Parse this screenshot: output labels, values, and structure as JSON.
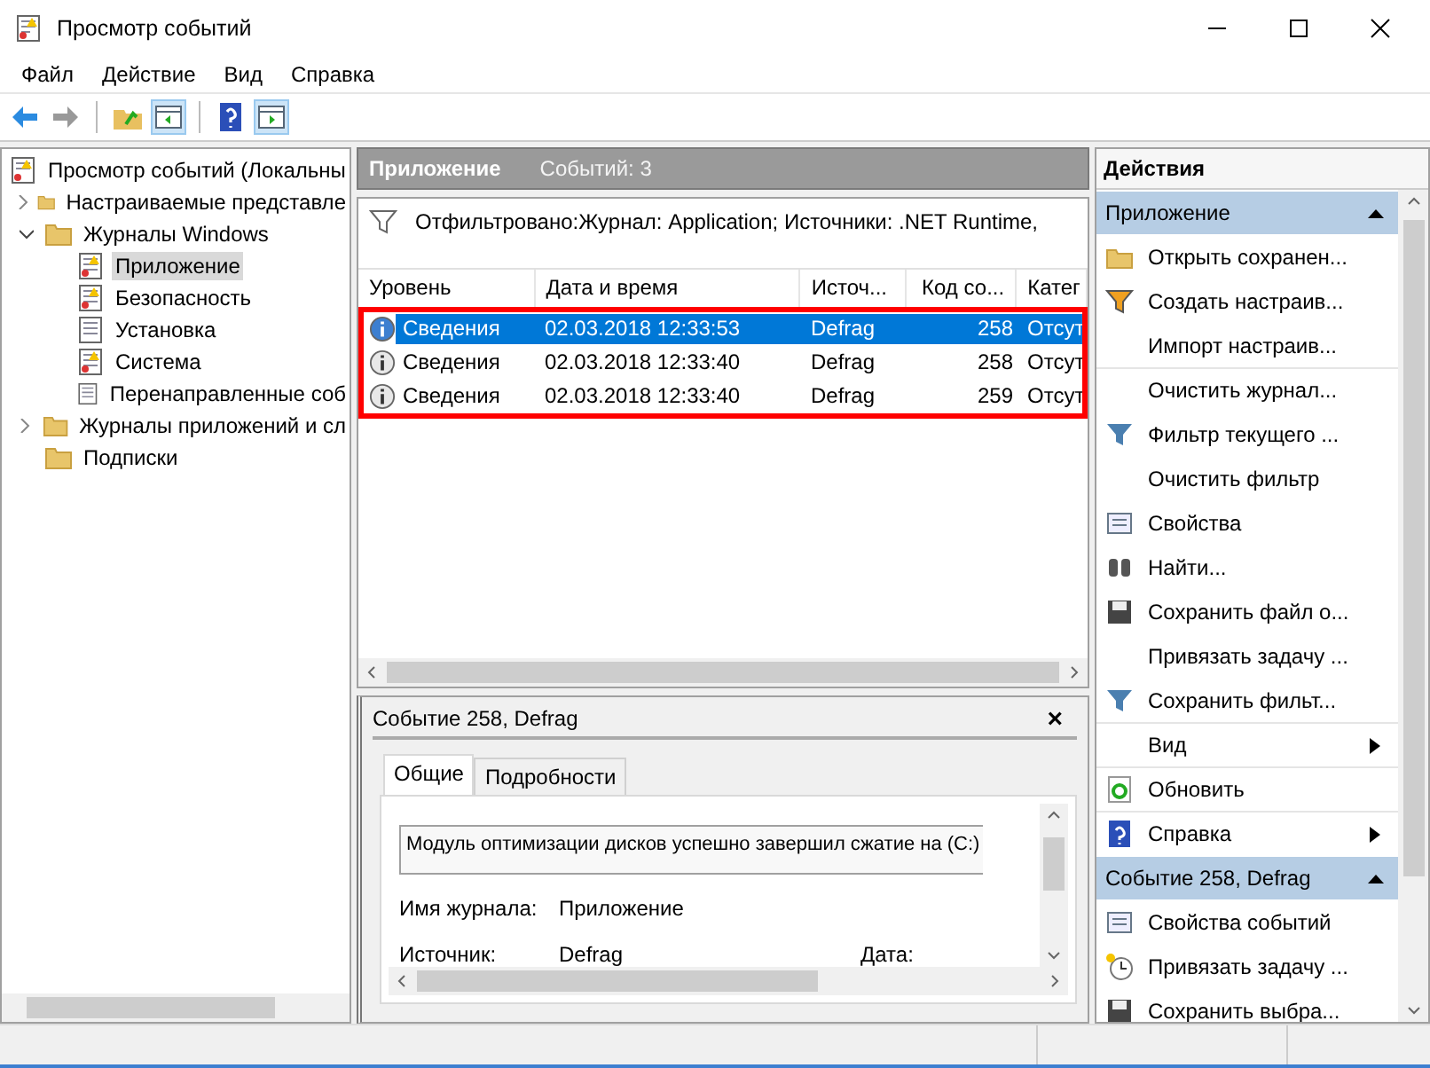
{
  "window": {
    "title": "Просмотр событий"
  },
  "menu": [
    "Файл",
    "Действие",
    "Вид",
    "Справка"
  ],
  "toolbar": [
    {
      "kind": "back"
    },
    {
      "kind": "forward"
    },
    {
      "kind": "sep"
    },
    {
      "kind": "up"
    },
    {
      "kind": "pane-left"
    },
    {
      "kind": "sep"
    },
    {
      "kind": "help"
    },
    {
      "kind": "pane-right"
    }
  ],
  "tree": [
    {
      "label": "Просмотр событий (Локальны",
      "selected": false,
      "children": [
        {
          "label": "Настраиваемые представле",
          "selected": false,
          "expanded": false
        },
        {
          "label": "Журналы Windows",
          "selected": false,
          "expanded": true,
          "children": [
            {
              "label": "Приложение",
              "kind": "log",
              "selected": true
            },
            {
              "label": "Безопасность",
              "kind": "log",
              "selected": false
            },
            {
              "label": "Установка",
              "kind": "list",
              "selected": false
            },
            {
              "label": "Система",
              "kind": "log",
              "selected": false
            },
            {
              "label": "Перенаправленные соб",
              "kind": "list",
              "selected": false
            }
          ]
        },
        {
          "label": "Журналы приложений и сл",
          "selected": false,
          "expanded": false
        },
        {
          "label": "Подписки",
          "selected": false
        }
      ]
    }
  ],
  "center": {
    "title": "Приложение",
    "count": "Событий: 3",
    "filter": "Отфильтровано:Журнал: Application; Источники: .NET Runtime,",
    "columns": [
      "Уровень",
      "Дата и время",
      "Источ...",
      "Код со...",
      "Катег"
    ],
    "rows": [
      {
        "level": "Сведения",
        "date": "02.03.2018 12:33:53",
        "source": "Defrag",
        "code": "258",
        "category": "Отсут",
        "selected": true
      },
      {
        "level": "Сведения",
        "date": "02.03.2018 12:33:40",
        "source": "Defrag",
        "code": "258",
        "category": "Отсут",
        "selected": false
      },
      {
        "level": "Сведения",
        "date": "02.03.2018 12:33:40",
        "source": "Defrag",
        "code": "259",
        "category": "Отсут",
        "selected": false
      }
    ],
    "highlight": true
  },
  "detail": {
    "title": "Событие 258, Defrag",
    "close": "×",
    "tabs": [
      {
        "label": "Общие",
        "selected": true
      },
      {
        "label": "Подробности",
        "selected": false
      }
    ],
    "message": "Модуль оптимизации дисков успешно завершил сжатие на (C:)",
    "fields": [
      {
        "label": "Имя журнала:",
        "value": "Приложение"
      },
      {
        "label": "Источник:",
        "value": "Defrag",
        "extra": "Дата:"
      }
    ]
  },
  "actions": {
    "title": "Действия",
    "groups": [
      {
        "title": "Приложение",
        "items": [
          {
            "label": "Открыть сохранен...",
            "kind": "folder",
            "submenu": false,
            "separator_before": false
          },
          {
            "label": "Создать настраив...",
            "kind": "filter-gold",
            "submenu": false,
            "separator_before": false
          },
          {
            "label": "Импорт настраив...",
            "kind": "plain",
            "submenu": false,
            "separator_before": false
          },
          {
            "label": "Очистить журнал...",
            "kind": "plain",
            "submenu": false,
            "separator_before": true
          },
          {
            "label": "Фильтр текущего ...",
            "kind": "filter",
            "submenu": false,
            "separator_before": false
          },
          {
            "label": "Очистить фильтр",
            "kind": "plain",
            "submenu": false,
            "separator_before": false
          },
          {
            "label": "Свойства",
            "kind": "props",
            "submenu": false,
            "separator_before": false
          },
          {
            "label": "Найти...",
            "kind": "find",
            "submenu": false,
            "separator_before": false
          },
          {
            "label": "Сохранить файл о...",
            "kind": "save",
            "submenu": false,
            "separator_before": false
          },
          {
            "label": "Привязать задачу ...",
            "kind": "plain",
            "submenu": false,
            "separator_before": false
          },
          {
            "label": "Сохранить фильт...",
            "kind": "filter",
            "submenu": false,
            "separator_before": false
          },
          {
            "label": "Вид",
            "kind": "plain",
            "submenu": true,
            "separator_before": true
          },
          {
            "label": "Обновить",
            "kind": "refresh",
            "submenu": false,
            "separator_before": true
          },
          {
            "label": "Справка",
            "kind": "help",
            "submenu": true,
            "separator_before": true
          }
        ]
      },
      {
        "title": "Событие 258, Defrag",
        "items": [
          {
            "label": "Свойства событий",
            "kind": "props",
            "submenu": false,
            "separator_before": false
          },
          {
            "label": "Привязать задачу ...",
            "kind": "task",
            "submenu": false,
            "separator_before": false
          },
          {
            "label": "Сохранить выбра...",
            "kind": "save",
            "submenu": false,
            "separator_before": false
          }
        ]
      }
    ]
  }
}
